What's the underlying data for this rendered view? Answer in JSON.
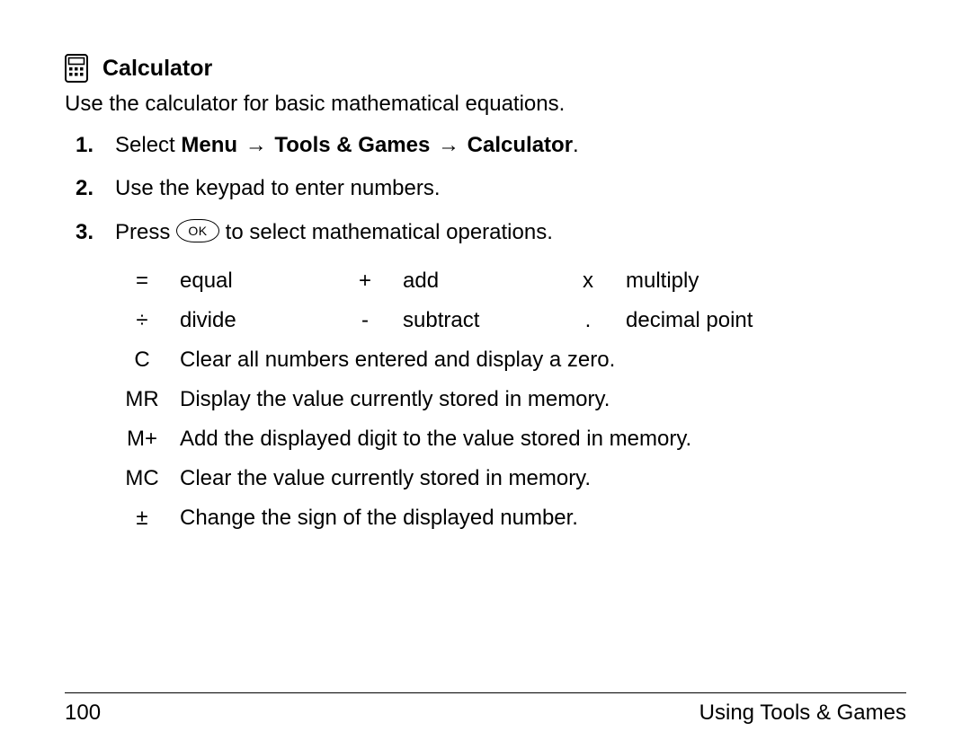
{
  "heading": "Calculator",
  "intro": "Use the calculator for basic mathematical equations.",
  "steps": {
    "s1": {
      "pre": "Select ",
      "menu": "Menu",
      "arrow1": "→",
      "tools": "Tools & Games",
      "arrow2": "→",
      "calc": "Calculator",
      "post": "."
    },
    "s2": "Use the keypad to enter numbers.",
    "s3": {
      "pre": "Press ",
      "key": "OK",
      "post": " to select mathematical operations."
    }
  },
  "ops_row1": {
    "c1s": "=",
    "c1l": "equal",
    "c2s": "+",
    "c2l": "add",
    "c3s": "x",
    "c3l": "multiply"
  },
  "ops_row2": {
    "c1s": "÷",
    "c1l": "divide",
    "c2s": "-",
    "c2l": "subtract",
    "c3s": ".",
    "c3l": "decimal point"
  },
  "ops_full": [
    {
      "sym": "C",
      "desc": "Clear all numbers entered and display a zero."
    },
    {
      "sym": "MR",
      "desc": "Display the value currently stored in memory."
    },
    {
      "sym": "M+",
      "desc": "Add the displayed digit to the value stored in memory."
    },
    {
      "sym": "MC",
      "desc": "Clear the value currently stored in memory."
    },
    {
      "sym": "±",
      "desc": "Change the sign of the displayed number."
    }
  ],
  "footer": {
    "page": "100",
    "section": "Using Tools & Games"
  }
}
